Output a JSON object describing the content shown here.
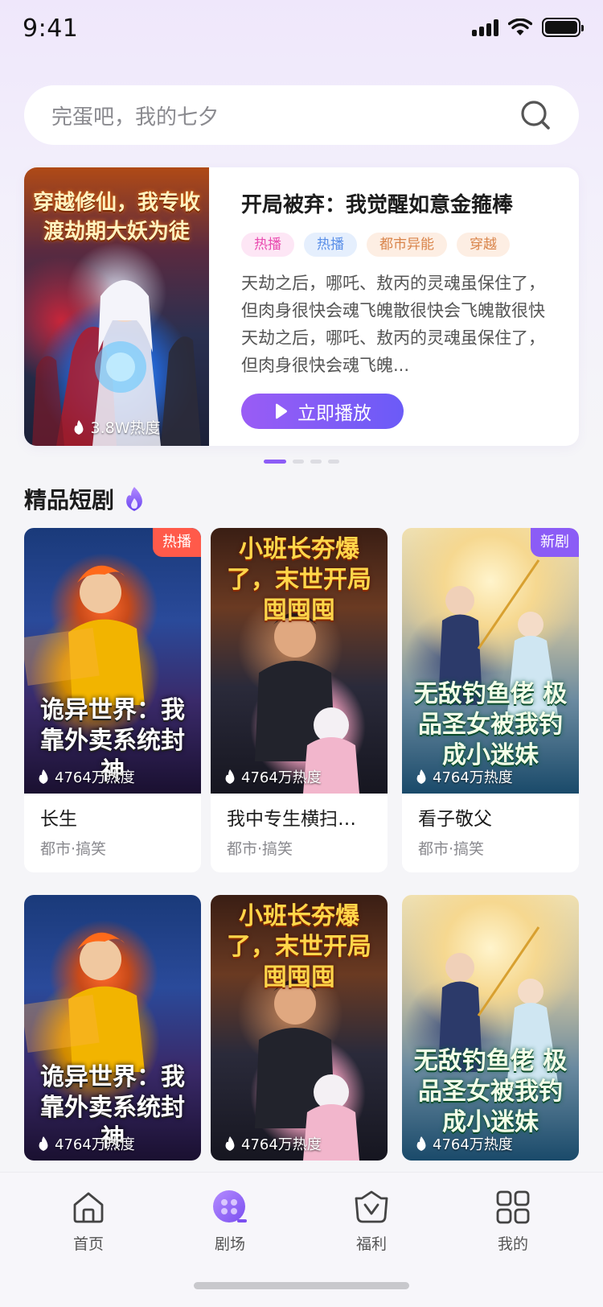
{
  "status_bar": {
    "time": "9:41"
  },
  "search": {
    "placeholder": "完蛋吧，我的七夕"
  },
  "banner": {
    "cover_title": "穿越修仙，我专收渡劫期大妖为徒",
    "heat": "3.8W热度",
    "title": "开局被弃：我觉醒如意金箍棒",
    "tags": [
      {
        "label": "热播",
        "color": "#e94cb0",
        "bg": "#fde6f5"
      },
      {
        "label": "热播",
        "color": "#5a8fe8",
        "bg": "#e5effd"
      },
      {
        "label": "都市异能",
        "color": "#d9844a",
        "bg": "#fdeee3"
      },
      {
        "label": "穿越",
        "color": "#d9844a",
        "bg": "#fdeee3"
      }
    ],
    "description": "天劫之后，哪吒、敖丙的灵魂虽保住了，但肉身很快会魂飞魄散很快会飞魄散很快天劫之后，哪吒、敖丙的灵魂虽保住了，但肉身很快会魂飞魄...",
    "play_label": "立即播放",
    "pages": 4,
    "active_page": 1
  },
  "section": {
    "title": "精品短剧"
  },
  "cards": [
    {
      "thumb_title": "诡异世界：我靠外卖系统封神",
      "heat": "4764万热度",
      "title": "长生",
      "genre": "都市·搞笑",
      "badge": "热播",
      "badge_color": "#ff5a4a"
    },
    {
      "thumb_title": "小班长夯爆了，末世开局囤囤囤",
      "heat": "4764万热度",
      "title": "我中专生横扫末世",
      "genre": "都市·搞笑",
      "badge": "",
      "badge_color": ""
    },
    {
      "thumb_title": "无敌钓鱼佬 极品圣女被我钓成小迷妹",
      "heat": "4764万热度",
      "title": "看子敬父",
      "genre": "都市·搞笑",
      "badge": "新剧",
      "badge_color": "#8b5cf6"
    },
    {
      "thumb_title": "诡异世界：我靠外卖系统封神",
      "heat": "4764万热度",
      "title": "",
      "genre": "",
      "badge": "",
      "badge_color": ""
    },
    {
      "thumb_title": "小班长夯爆了，末世开局囤囤囤",
      "heat": "4764万热度",
      "title": "",
      "genre": "",
      "badge": "",
      "badge_color": ""
    },
    {
      "thumb_title": "无敌钓鱼佬 极品圣女被我钓成小迷妹",
      "heat": "4764万热度",
      "title": "",
      "genre": "",
      "badge": "",
      "badge_color": ""
    }
  ],
  "tabbar": {
    "items": [
      {
        "label": "首页",
        "icon": "home-icon"
      },
      {
        "label": "剧场",
        "icon": "theater-icon",
        "active": true
      },
      {
        "label": "福利",
        "icon": "gift-icon"
      },
      {
        "label": "我的",
        "icon": "profile-grid-icon"
      }
    ],
    "accent": "#8b5cf6"
  }
}
